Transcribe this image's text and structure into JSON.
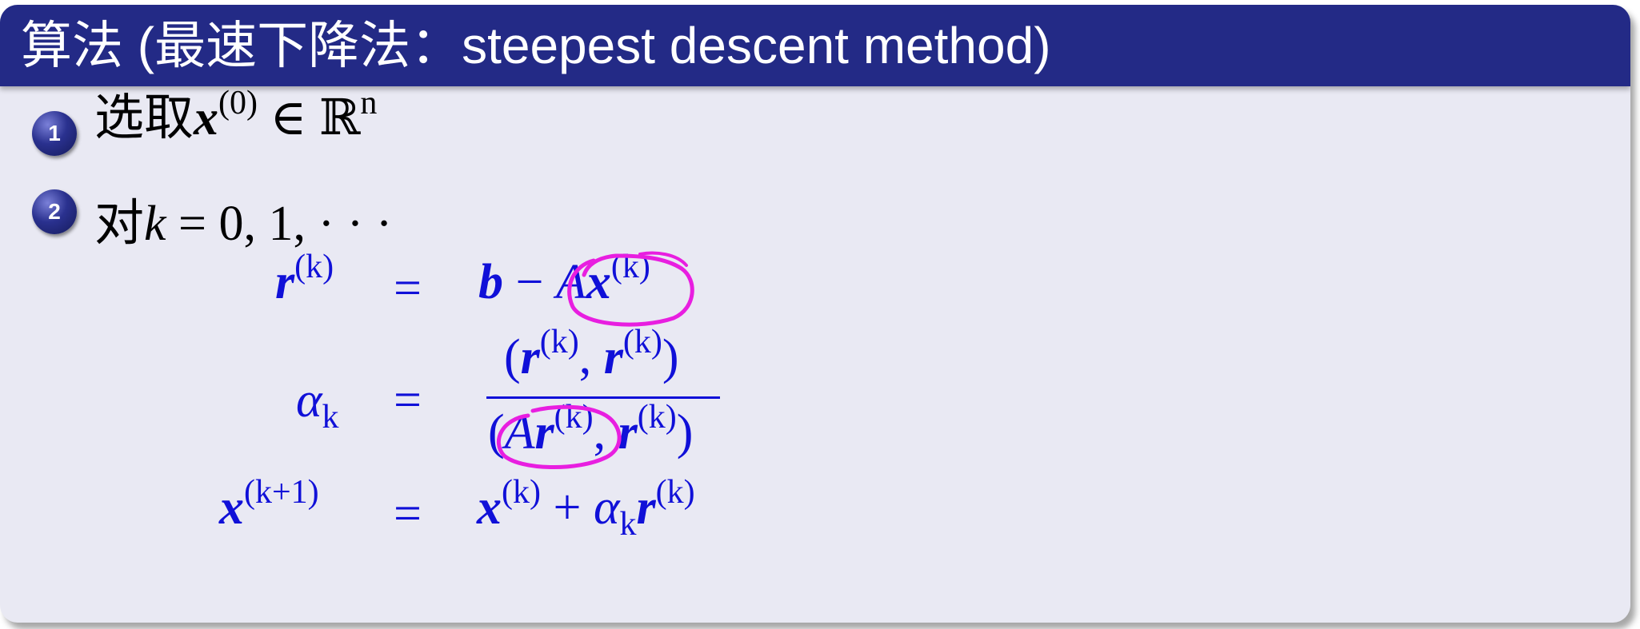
{
  "title": "算法 (最速下降法：steepest descent method)",
  "items": [
    {
      "number": "1",
      "text": "选取",
      "var": "x",
      "sup": "(0)",
      "rest": " ∈ ℝ",
      "rest_sup": "n"
    },
    {
      "number": "2",
      "text": "对",
      "var": "k",
      "rest": " = 0, 1, · · ·"
    }
  ],
  "equations": {
    "r_lhs": "r",
    "r_sup": "(k)",
    "eq_sign": "=",
    "r_rhs_b": "b",
    "r_rhs_minus": " − ",
    "r_rhs_A": "A",
    "r_rhs_x": "x",
    "r_rhs_sup": "(k)",
    "alpha_lhs": "α",
    "alpha_sub": "k",
    "num_open": "(",
    "num_r1": "r",
    "num_sup1": "(k)",
    "num_comma": ", ",
    "num_r2": "r",
    "num_sup2": "(k)",
    "num_close": ")",
    "den_open": "(",
    "den_A": "A",
    "den_r1": "r",
    "den_sup1": "(k)",
    "den_comma": ", ",
    "den_r2": "r",
    "den_sup2": "(k)",
    "den_close": ")",
    "x_lhs": "x",
    "x_sup": "(k+1)",
    "x_rhs_x": "x",
    "x_rhs_sup": "(k)",
    "x_rhs_plus": " + ",
    "x_rhs_alpha": "α",
    "x_rhs_sub": "k",
    "x_rhs_r": "r",
    "x_rhs_rsup": "(k)"
  },
  "colors": {
    "title_bg": "#232a86",
    "body_bg": "#e9e9f3",
    "math": "#1010d8",
    "annotation": "#e81ee0"
  }
}
